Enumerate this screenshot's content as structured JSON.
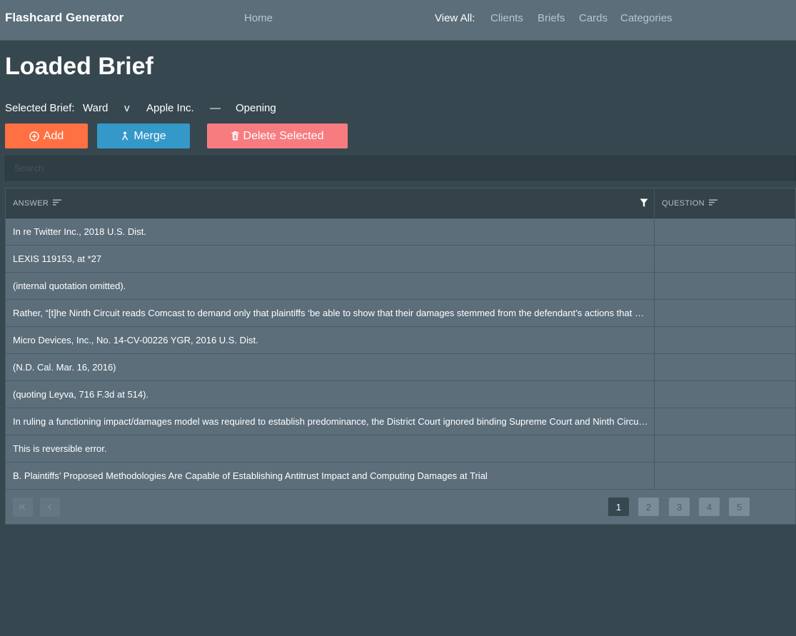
{
  "navbar": {
    "brand": "Flashcard Generator",
    "home": "Home",
    "view_all_label": "View All:",
    "links": [
      "Clients",
      "Briefs",
      "Cards",
      "Categories"
    ]
  },
  "page": {
    "title": "Loaded Brief",
    "selected_brief_label": "Selected Brief:",
    "brief": {
      "plaintiff": "Ward",
      "versus": "v",
      "defendant": "Apple Inc.",
      "dash": "—",
      "type": "Opening"
    }
  },
  "toolbar": {
    "add_label": "Add",
    "merge_label": "Merge",
    "delete_label": "Delete Selected"
  },
  "search": {
    "placeholder": "Search",
    "value": ""
  },
  "table": {
    "columns": [
      "ANSWER",
      "QUESTION"
    ],
    "rows": [
      {
        "answer": "In re Twitter Inc., 2018 U.S. Dist.",
        "question": ""
      },
      {
        "answer": "LEXIS 119153, at *27",
        "question": ""
      },
      {
        "answer": "(internal quotation omitted).",
        "question": ""
      },
      {
        "answer": "Rather, “[t]he Ninth Circuit reads Comcast to demand only that plaintiffs ‘be able to show that their damages stemmed from the defendant’s actions that created the legal liability.’”",
        "question": ""
      },
      {
        "answer": "Micro Devices, Inc., No. 14-CV-00226 YGR, 2016 U.S. Dist.",
        "question": ""
      },
      {
        "answer": "(N.D. Cal. Mar. 16, 2016)",
        "question": ""
      },
      {
        "answer": "(quoting Leyva, 716 F.3d at 514).",
        "question": ""
      },
      {
        "answer": "In ruling a functioning impact/damages model was required to establish predominance, the District Court ignored binding Supreme Court and Ninth Circuit precedent.",
        "question": ""
      },
      {
        "answer": "This is reversible error.",
        "question": ""
      },
      {
        "answer": "B. Plaintiffs’ Proposed Methodologies Are Capable of Establishing Antitrust Impact and Computing Damages at Trial",
        "question": ""
      }
    ]
  },
  "pagination": {
    "current": "1",
    "pages": [
      "1",
      "2",
      "3",
      "4",
      "5"
    ]
  },
  "colors": {
    "add": "#ff7043",
    "merge": "#3498c8",
    "delete": "#f77c80",
    "background": "#37474f",
    "navbar": "#5b6e7a"
  }
}
